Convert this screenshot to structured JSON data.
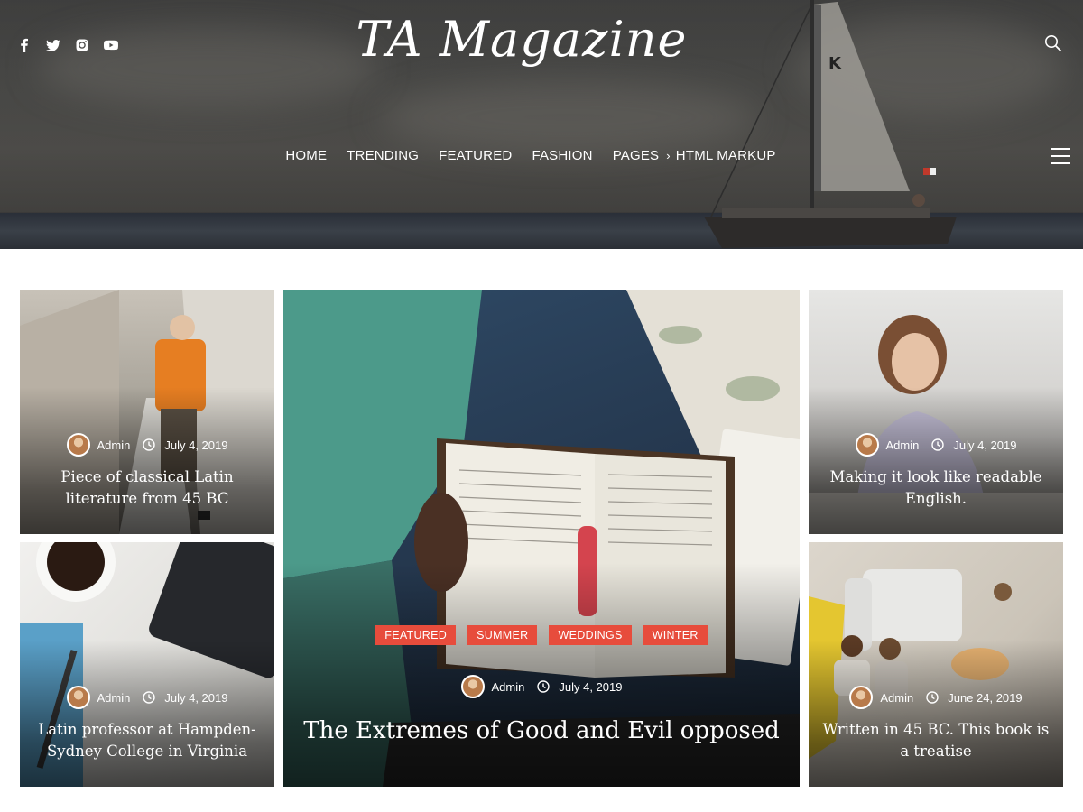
{
  "site": {
    "logo": "TA Magazine",
    "social_icons": [
      "facebook-icon",
      "twitter-icon",
      "instagram-icon",
      "youtube-icon"
    ],
    "search_icon": "search-icon",
    "menu_icon": "hamburger-icon"
  },
  "nav": {
    "items": [
      "HOME",
      "TRENDING",
      "FEATURED",
      "FASHION",
      "PAGES",
      "HTML MARKUP"
    ]
  },
  "colors": {
    "accent": "#e74c3c",
    "text_light": "#ffffff"
  },
  "posts": {
    "left_top": {
      "author": "Admin",
      "date": "July 4, 2019",
      "title": "Piece of classical Latin literature from 45 BC"
    },
    "left_bottom": {
      "author": "Admin",
      "date": "July 4, 2019",
      "title": "Latin professor at Hampden-Sydney College in Virginia"
    },
    "featured": {
      "author": "Admin",
      "date": "July 4, 2019",
      "title": "The Extremes of Good and Evil opposed",
      "tags": [
        "FEATURED",
        "SUMMER",
        "WEDDINGS",
        "WINTER"
      ]
    },
    "right_top": {
      "author": "Admin",
      "date": "July 4, 2019",
      "title": "Making it look like readable English."
    },
    "right_bottom": {
      "author": "Admin",
      "date": "June 24, 2019",
      "title": "Written in 45 BC. This book is a treatise"
    }
  }
}
